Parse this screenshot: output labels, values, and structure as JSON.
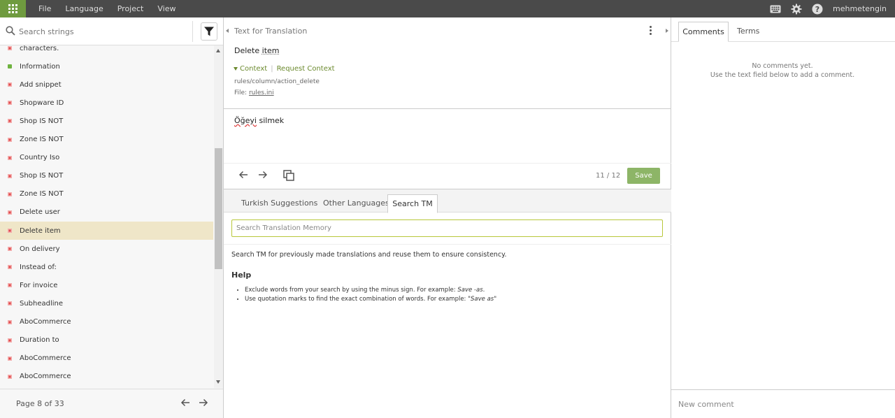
{
  "menu": [
    "File",
    "Language",
    "Project",
    "View"
  ],
  "user": {
    "name": "mehmetengin"
  },
  "left": {
    "search_placeholder": "Search strings",
    "items": [
      {
        "label": "characters.",
        "status": "red"
      },
      {
        "label": "Information",
        "status": "green"
      },
      {
        "label": "Add snippet",
        "status": "red"
      },
      {
        "label": "Shopware ID",
        "status": "red"
      },
      {
        "label": "Shop IS NOT",
        "status": "red"
      },
      {
        "label": "Zone IS NOT",
        "status": "red"
      },
      {
        "label": "Country Iso",
        "status": "red"
      },
      {
        "label": "Shop IS NOT",
        "status": "red"
      },
      {
        "label": "Zone IS NOT",
        "status": "red"
      },
      {
        "label": "Delete user",
        "status": "red"
      },
      {
        "label": "Delete item",
        "status": "red",
        "selected": true
      },
      {
        "label": "On delivery",
        "status": "red"
      },
      {
        "label": "Instead of:",
        "status": "red"
      },
      {
        "label": "For invoice",
        "status": "red"
      },
      {
        "label": "Subheadline",
        "status": "red"
      },
      {
        "label": "AboCommerce",
        "status": "red"
      },
      {
        "label": "Duration to",
        "status": "red"
      },
      {
        "label": "AboCommerce",
        "status": "red"
      },
      {
        "label": "AboCommerce",
        "status": "red"
      }
    ],
    "pager": "Page 8 of 33"
  },
  "center": {
    "header_title": "Text for Translation",
    "source": {
      "pre": "Delete ",
      "underlined": "item"
    },
    "context_label": "Context",
    "request_context": "Request Context",
    "key": "rules/column/action_delete",
    "file_label": "File: ",
    "file_name": "rules.ini",
    "translation": {
      "misspelled": "Öğeyi",
      "rest": " silmek"
    },
    "counter": "11 / 12",
    "save_label": "Save",
    "tabs": [
      "Turkish Suggestions",
      "Other Languages",
      "Search TM"
    ],
    "tm_placeholder": "Search Translation Memory",
    "tm_description": "Search TM for previously made translations and reuse them to ensure consistency.",
    "help": {
      "title": "Help",
      "item1_text": "Exclude words from your search by using the minus sign. For example: ",
      "item1_example": "Save -as",
      "item1_end": ".",
      "item2_text": "Use quotation marks to find the exact combination of words. For example: ",
      "item2_example": "\"Save as\""
    }
  },
  "right": {
    "tabs": [
      "Comments",
      "Terms"
    ],
    "no_comments_line1": "No comments yet.",
    "no_comments_line2": "Use the text field below to add a comment.",
    "comment_placeholder": "New comment"
  },
  "colors": {
    "topbar": "#4a4a4a",
    "app_button": "#6f9b3f",
    "selected_row": "#efe6c8",
    "save_button": "#8db567",
    "context_link": "#6b8a2e",
    "status_red": "#e0484a",
    "status_green": "#6fb33f"
  }
}
